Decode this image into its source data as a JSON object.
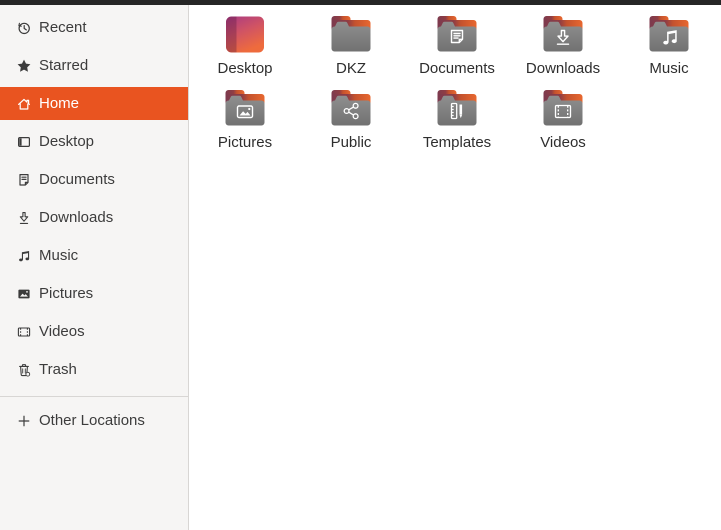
{
  "colors": {
    "accent": "#e95420",
    "topbar": "#262626",
    "sidebar_bg": "#f6f5f4",
    "content_bg": "#ffffff",
    "border": "#d8d6d4",
    "text": "#3c3c3c",
    "label_text": "#2e2e2e",
    "folder_tab_dark": "#7c3a4e",
    "folder_tab_orange": "#e8682f",
    "folder_body_gray": "#808080",
    "desktop_icon_purple": "#a93a83",
    "desktop_icon_orange": "#ee6b3d"
  },
  "sidebar": {
    "items": [
      {
        "label": "Recent",
        "icon": "recent-icon",
        "selected": false
      },
      {
        "label": "Starred",
        "icon": "star-icon",
        "selected": false
      },
      {
        "label": "Home",
        "icon": "home-icon",
        "selected": true
      },
      {
        "label": "Desktop",
        "icon": "desktop-icon",
        "selected": false
      },
      {
        "label": "Documents",
        "icon": "documents-icon",
        "selected": false
      },
      {
        "label": "Downloads",
        "icon": "downloads-icon",
        "selected": false
      },
      {
        "label": "Music",
        "icon": "music-icon",
        "selected": false
      },
      {
        "label": "Pictures",
        "icon": "pictures-icon",
        "selected": false
      },
      {
        "label": "Videos",
        "icon": "videos-icon",
        "selected": false
      },
      {
        "label": "Trash",
        "icon": "trash-icon",
        "selected": false
      }
    ],
    "footer": {
      "label": "Other Locations",
      "icon": "plus-icon"
    }
  },
  "files": {
    "items": [
      {
        "name": "Desktop",
        "icon": "desktop-special-icon"
      },
      {
        "name": "DKZ",
        "icon": "folder-icon"
      },
      {
        "name": "Documents",
        "icon": "folder-documents-icon"
      },
      {
        "name": "Downloads",
        "icon": "folder-downloads-icon"
      },
      {
        "name": "Music",
        "icon": "folder-music-icon"
      },
      {
        "name": "Pictures",
        "icon": "folder-pictures-icon"
      },
      {
        "name": "Public",
        "icon": "folder-public-icon"
      },
      {
        "name": "Templates",
        "icon": "folder-templates-icon"
      },
      {
        "name": "Videos",
        "icon": "folder-videos-icon"
      }
    ]
  }
}
